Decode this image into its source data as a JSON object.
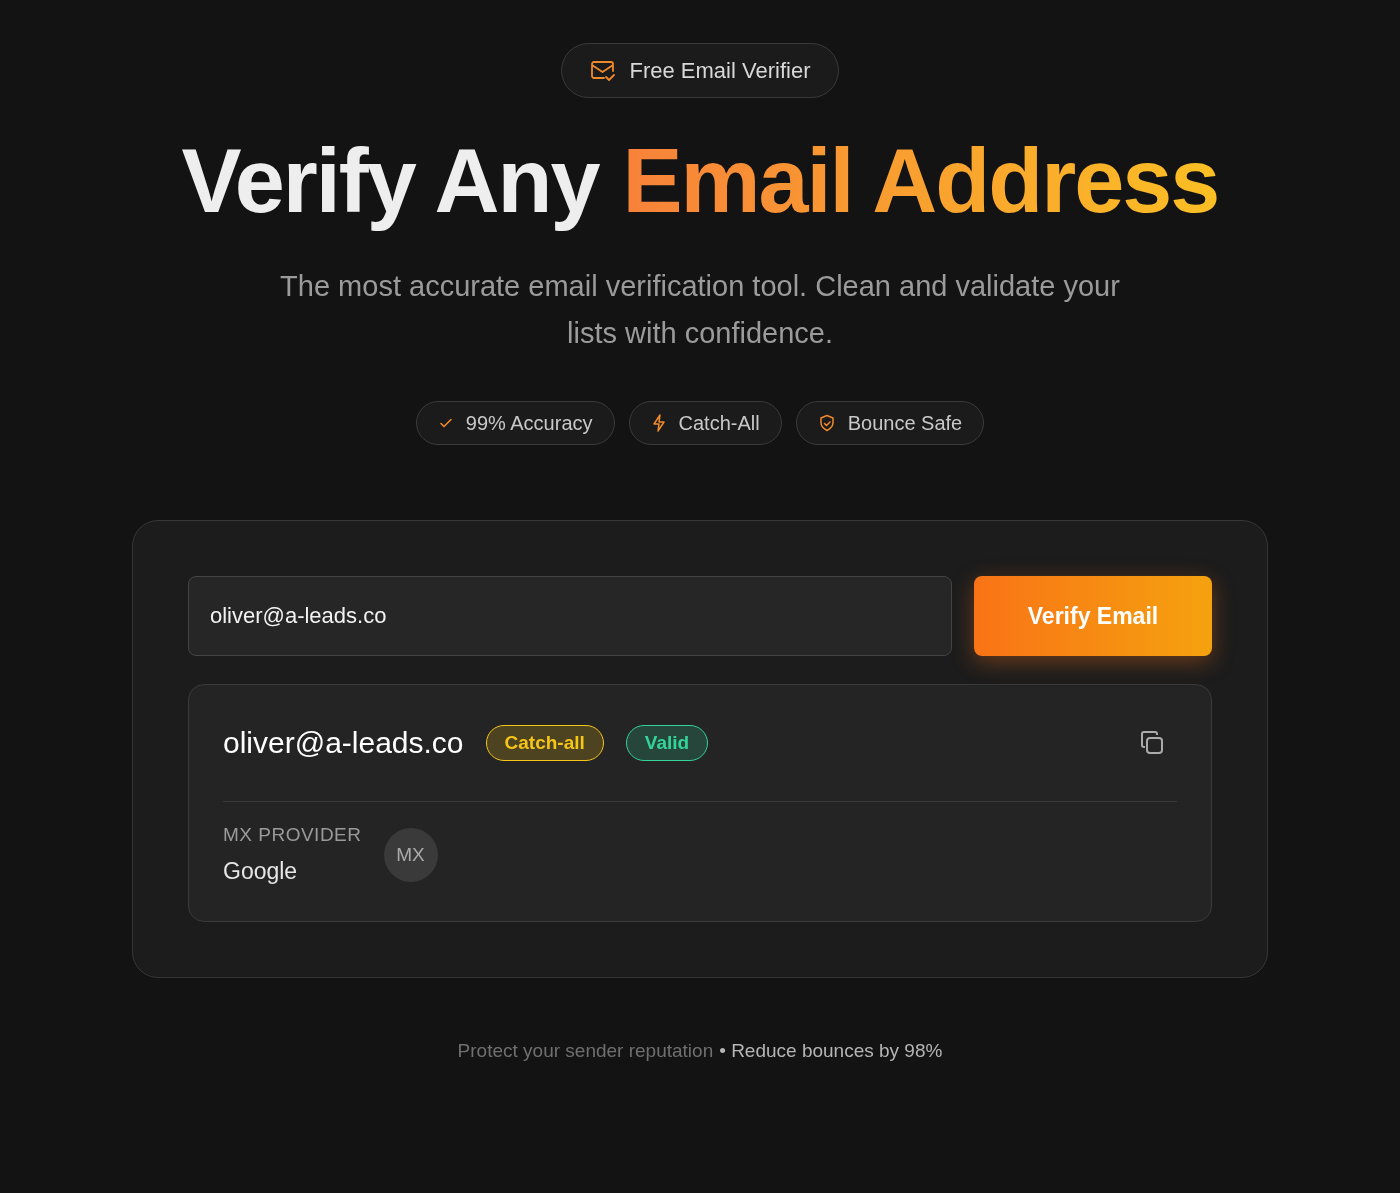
{
  "badge": {
    "label": "Free Email Verifier"
  },
  "headline": {
    "plain": "Verify Any",
    "accent": "Email Address"
  },
  "subtitle": "The most accurate email verification tool. Clean and validate your lists with confidence.",
  "features": [
    {
      "label": "99% Accuracy",
      "kind": "check"
    },
    {
      "label": "Catch-All",
      "kind": "bolt"
    },
    {
      "label": "Bounce Safe",
      "kind": "shield"
    }
  ],
  "form": {
    "email_value": "oliver@a-leads.co",
    "button": "Verify Email"
  },
  "result": {
    "email": "oliver@a-leads.co",
    "tags": [
      {
        "label": "Catch-all",
        "color": "#f5c518"
      },
      {
        "label": "Valid",
        "color": "#34d399"
      }
    ],
    "mx_label": "MX PROVIDER",
    "mx_value": "Google",
    "mx_avatar": "MX"
  },
  "footer": {
    "note": "Protect your sender reputation",
    "highlight": "• Reduce bounces by 98%"
  }
}
